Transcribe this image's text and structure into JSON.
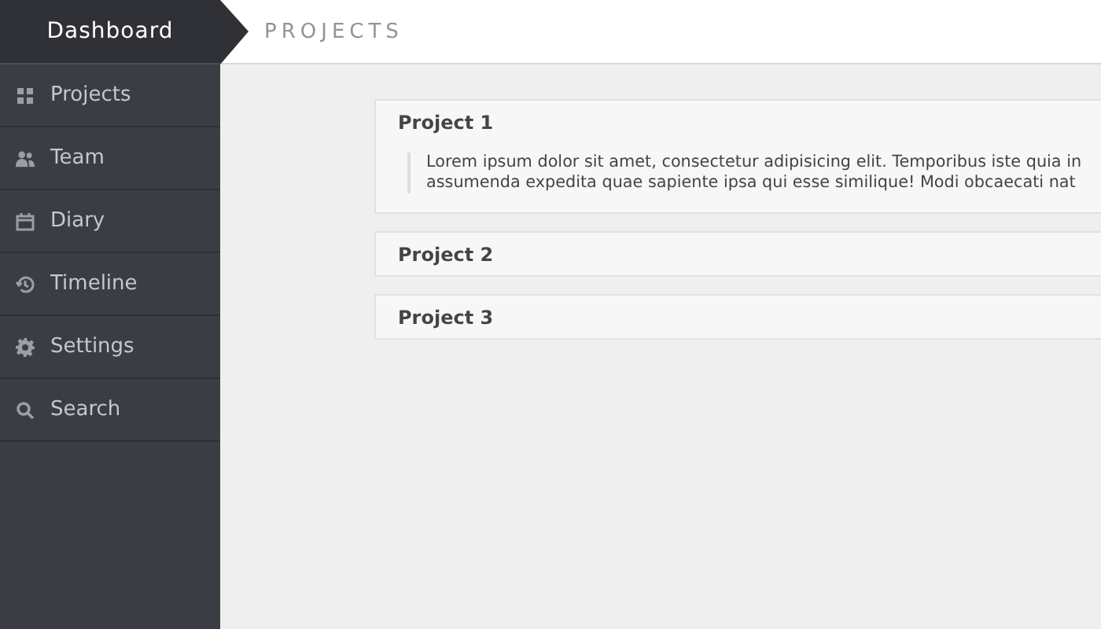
{
  "brand": "Dashboard",
  "page_title": "PROJECTS",
  "sidebar": {
    "items": [
      {
        "label": "Projects"
      },
      {
        "label": "Team"
      },
      {
        "label": "Diary"
      },
      {
        "label": "Timeline"
      },
      {
        "label": "Settings"
      },
      {
        "label": "Search"
      }
    ]
  },
  "panels": [
    {
      "title": "Project 1",
      "body": [
        "Lorem ipsum dolor sit amet, consectetur adipisicing elit. Temporibus iste quia in",
        "assumenda expedita quae sapiente ipsa qui esse similique! Modi obcaecati nat"
      ]
    },
    {
      "title": "Project 2"
    },
    {
      "title": "Project 3"
    }
  ]
}
